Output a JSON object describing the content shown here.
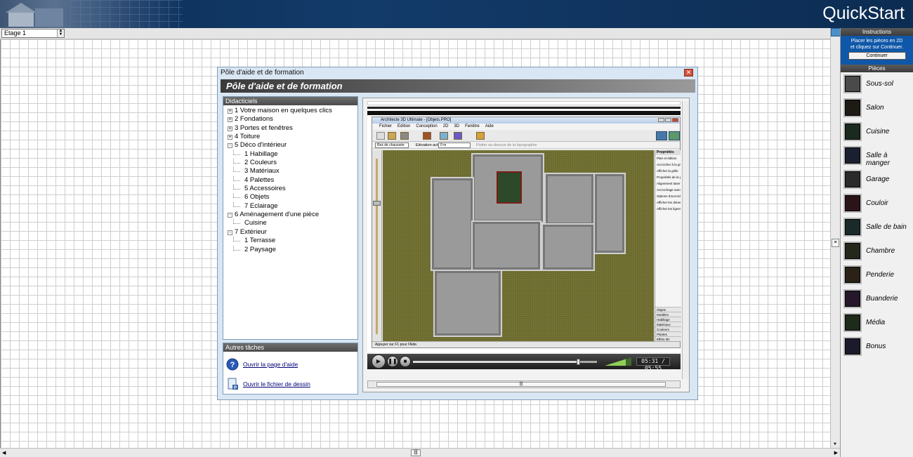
{
  "header": {
    "title": "QuickStart"
  },
  "floor_selector": {
    "value": "Etage 1"
  },
  "right_panel": {
    "instructions_title": "Instructions",
    "instructions_line1": "Placer les pièces en 2D",
    "instructions_line2": "et cliquez sur Continuer.",
    "continue_label": "Continuer",
    "rooms_title": "Pièces",
    "rooms": [
      {
        "label": "Sous-sol",
        "color": "#4a4a4a"
      },
      {
        "label": "Salon",
        "color": "#1e1a14"
      },
      {
        "label": "Cuisine",
        "color": "#1a2a1e"
      },
      {
        "label": "Salle à manger",
        "color": "#1a2030"
      },
      {
        "label": "Garage",
        "color": "#2a2a2a"
      },
      {
        "label": "Couloir",
        "color": "#2a1418"
      },
      {
        "label": "Salle de bain",
        "color": "#1a2a2a"
      },
      {
        "label": "Chambre",
        "color": "#24281a"
      },
      {
        "label": "Penderie",
        "color": "#2a2216"
      },
      {
        "label": "Buanderie",
        "color": "#24182a"
      },
      {
        "label": "Média",
        "color": "#1e2a1a"
      },
      {
        "label": "Bonus",
        "color": "#1a1a2a"
      }
    ]
  },
  "dialog": {
    "window_title": "Pôle d'aide et de formation",
    "banner_title": "Pôle d'aide et de formation",
    "tree_title": "Didacticiels",
    "tree": [
      {
        "label": "1 Votre maison en quelques clics",
        "level": 0,
        "toggle": "+"
      },
      {
        "label": "2 Fondations",
        "level": 0,
        "toggle": "+"
      },
      {
        "label": "3 Portes et fenêtres",
        "level": 0,
        "toggle": "+"
      },
      {
        "label": "4 Toiture",
        "level": 0,
        "toggle": "+"
      },
      {
        "label": "5 Déco d'intérieur",
        "level": 0,
        "toggle": "-"
      },
      {
        "label": "1 Habillage",
        "level": 1,
        "toggle": ""
      },
      {
        "label": "2 Couleurs",
        "level": 1,
        "toggle": ""
      },
      {
        "label": "3 Matériaux",
        "level": 1,
        "toggle": ""
      },
      {
        "label": "4 Palettes",
        "level": 1,
        "toggle": ""
      },
      {
        "label": "5 Accessoires",
        "level": 1,
        "toggle": ""
      },
      {
        "label": "6 Objets",
        "level": 1,
        "toggle": ""
      },
      {
        "label": "7 Eclairage",
        "level": 1,
        "toggle": ""
      },
      {
        "label": "6 Aménagement d'une pièce",
        "level": 0,
        "toggle": "-"
      },
      {
        "label": "Cuisine",
        "level": 1,
        "toggle": ""
      },
      {
        "label": "7 Extérieur",
        "level": 0,
        "toggle": "-"
      },
      {
        "label": "1 Terrasse",
        "level": 1,
        "toggle": ""
      },
      {
        "label": "2 Paysage",
        "level": 1,
        "toggle": ""
      }
    ],
    "tasks_title": "Autres tâches",
    "tasks": [
      {
        "label": "Ouvrir la page d'aide",
        "icon": "help-icon"
      },
      {
        "label": "Ouvrir le fichier de dessin",
        "icon": "document-icon"
      }
    ],
    "video": {
      "time": "05:31 / 05:55",
      "progress": 0.9,
      "inner_app": {
        "title": "Architecte 3D Ultimate - [Objets.PRO]",
        "menu": [
          "Fichier",
          "Edition",
          "Conception",
          "2D",
          "3D",
          "Fenêtre",
          "Aide"
        ],
        "floor_select": "Rez de chaussée",
        "elevation_label": "Elévation active",
        "elevation_value": "0 m",
        "terrain_option": "Flotter au-dessus de la topographie",
        "properties_title": "Propriétés",
        "properties_sub": "Plan et édition",
        "properties": [
          "Accrocher à la grille",
          "Afficher la grille",
          "Propriétés de la g",
          "Alignement laser",
          "Accrochage automatique",
          "Options d'accroch",
          "Afficher les dimensions",
          "Afficher les lignes"
        ],
        "tabs": [
          "Objets",
          "Modèles",
          "Habillage",
          "Matériaux",
          "Couleurs",
          "Plantes",
          "Effets 3D"
        ],
        "status": "Appuyer sur F1 pour l'Aide."
      }
    }
  }
}
